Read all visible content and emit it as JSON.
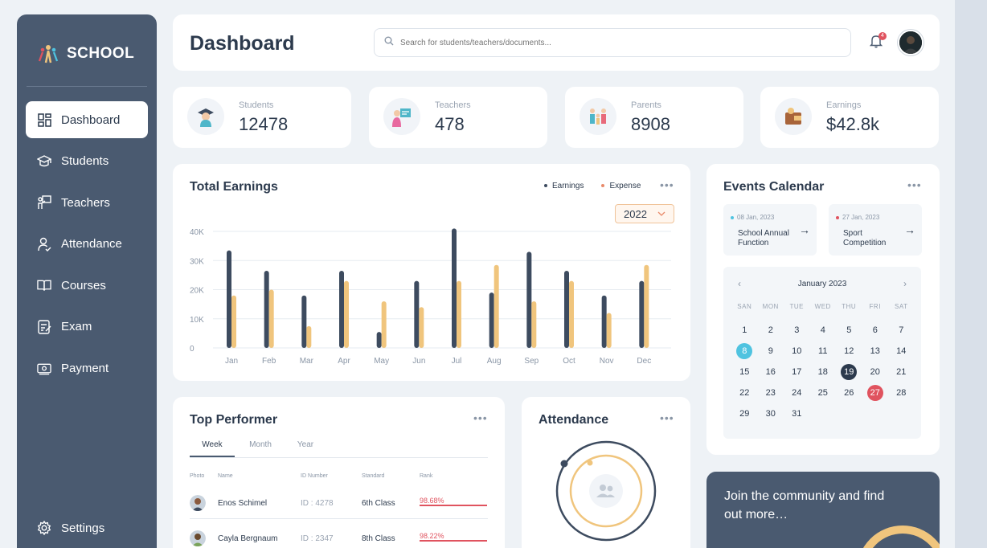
{
  "app": {
    "logo_text": "SCHOOL"
  },
  "sidebar": {
    "items": [
      {
        "label": "Dashboard",
        "icon": "dashboard-icon"
      },
      {
        "label": "Students",
        "icon": "graduation-cap-icon"
      },
      {
        "label": "Teachers",
        "icon": "teacher-icon"
      },
      {
        "label": "Attendance",
        "icon": "user-check-icon"
      },
      {
        "label": "Courses",
        "icon": "book-icon"
      },
      {
        "label": "Exam",
        "icon": "exam-icon"
      },
      {
        "label": "Payment",
        "icon": "payment-icon"
      }
    ],
    "active_index": 0,
    "settings_label": "Settings"
  },
  "header": {
    "title": "Dashboard",
    "search_placeholder": "Search for students/teachers/documents...",
    "notification_count": "4"
  },
  "stats": [
    {
      "label": "Students",
      "value": "12478",
      "icon": "student-icon"
    },
    {
      "label": "Teachers",
      "value": "478",
      "icon": "teacher-board-icon"
    },
    {
      "label": "Parents",
      "value": "8908",
      "icon": "family-icon"
    },
    {
      "label": "Earnings",
      "value": "$42.8k",
      "icon": "wallet-icon"
    }
  ],
  "earnings": {
    "title": "Total Earnings",
    "legend": [
      {
        "label": "Earnings",
        "color": "#3d4b5f"
      },
      {
        "label": "Expense",
        "color": "#f0c57d"
      }
    ],
    "year": "2022"
  },
  "chart_data": {
    "type": "bar",
    "title": "Total Earnings",
    "categories": [
      "Jan",
      "Feb",
      "Mar",
      "Apr",
      "May",
      "Jun",
      "Jul",
      "Aug",
      "Sep",
      "Oct",
      "Nov",
      "Dec"
    ],
    "series": [
      {
        "name": "Earnings",
        "values": [
          33500,
          26500,
          18000,
          26500,
          5500,
          23000,
          41000,
          19000,
          33000,
          26500,
          18000,
          23000
        ]
      },
      {
        "name": "Expense",
        "values": [
          18000,
          20000,
          7500,
          23000,
          16000,
          14000,
          23000,
          28500,
          16000,
          23000,
          12000,
          28500
        ]
      }
    ],
    "yticks": [
      "0",
      "10K",
      "20K",
      "30K",
      "40K"
    ],
    "ylim": [
      0,
      40000
    ],
    "grid": true,
    "legend": "top-right"
  },
  "events": {
    "title": "Events Calendar",
    "items": [
      {
        "date": "08 Jan, 2023",
        "name": "School Annual Function",
        "color": "#4fc3e0"
      },
      {
        "date": "27 Jan, 2023",
        "name": "Sport Competition",
        "color": "#e0535f"
      }
    ],
    "calendar": {
      "month": "January 2023",
      "weekdays": [
        "SAN",
        "MON",
        "TUE",
        "WED",
        "THU",
        "FRI",
        "SAT"
      ],
      "days": [
        1,
        2,
        3,
        4,
        5,
        6,
        7,
        8,
        9,
        10,
        11,
        12,
        13,
        14,
        15,
        16,
        17,
        18,
        19,
        20,
        21,
        22,
        23,
        24,
        25,
        26,
        27,
        28,
        29,
        30,
        31
      ],
      "highlight_today": 8,
      "selected": 19,
      "event_day": 27
    }
  },
  "performer": {
    "title": "Top Performer",
    "tabs": [
      "Week",
      "Month",
      "Year"
    ],
    "active_tab": 0,
    "columns": [
      "Photo",
      "Name",
      "ID Number",
      "Standard",
      "Rank"
    ],
    "rows": [
      {
        "name": "Enos Schimel",
        "id": "ID : 4278",
        "standard": "6th Class",
        "rank": "98.68%"
      },
      {
        "name": "Cayla Bergnaum",
        "id": "ID : 2347",
        "standard": "8th Class",
        "rank": "98.22%"
      }
    ]
  },
  "attendance": {
    "title": "Attendance"
  },
  "community": {
    "text": "Join the community and find out more…"
  }
}
